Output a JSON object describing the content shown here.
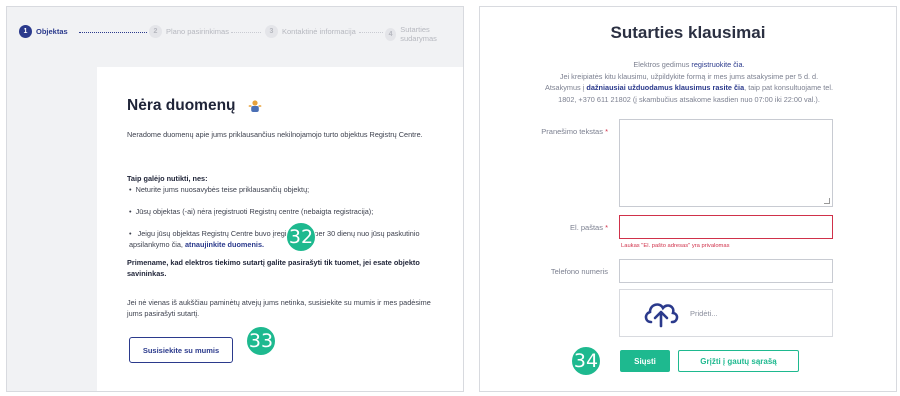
{
  "stepper": {
    "steps": [
      {
        "num": "1",
        "label": "Objektas"
      },
      {
        "num": "2",
        "label": "Plano pasirinkimas"
      },
      {
        "num": "3",
        "label": "Kontaktinė informacija"
      },
      {
        "num": "4",
        "label": "Sutarties sudarymas"
      }
    ]
  },
  "left": {
    "title": "Nėra duomenų",
    "intro": "Neradome duomenų apie jums priklausančius nekilnojamojo turto objektus Registrų Centre.",
    "reasons_title": "Taip galėjo nutikti, nes:",
    "reason1": "Neturite jums nuosavybės teise priklausančių objektų;",
    "reason2": "Jūsų objektas (-ai) nėra įregistruoti Registrų centre (nebaigta registracija);",
    "reason3_pre": "Jeigu jūsų objektas Registrų Centre buvo įregistruotas per 30 dienų nuo jūsų paskutinio apsilankymo čia,",
    "reason3_link": "atnaujinkite duomenis.",
    "reminder": "Primename, kad elektros tiekimo sutartį galite pasirašyti tik tuomet, jei esate objekto savininkas.",
    "contact_text": "Jei nė vienas iš aukščiau paminėtų atvejų jums netinka, susisiekite su mumis ir mes padėsime jums pasirašyti sutartį.",
    "contact_button": "Susisiekite su mumis"
  },
  "badges": {
    "b32": "32",
    "b33": "33",
    "b34": "34"
  },
  "right": {
    "title": "Sutarties klausimai",
    "desc_line1_pre": "Elektros gedimus",
    "desc_line1_link": "registruokite čia.",
    "desc_line2": "Jei kreipiatės kitu klausimu, užpildykite formą ir mes jums atsakysime per 5 d. d.",
    "desc_line3_pre": "Atsakymus į",
    "desc_line3_link": "dažniausiai užduodamus klausimus rasite čia",
    "desc_line3_post": ", taip pat konsultuojame tel.",
    "desc_line4": "1802, +370 611 21802 (į skambučius atsakome kasdien nuo 07:00 iki 22:00 val.).",
    "message_label": "Pranešimo tekstas",
    "email_label": "El. paštas",
    "required_mark": "*",
    "email_error": "Laukas \"El. pašto adresas\" yra privalomas",
    "phone_label": "Telefono numeris",
    "upload_label": "Pridėti...",
    "send_button": "Siųsti",
    "back_button": "Grįžti į gautų sąrašą"
  },
  "colors": {
    "accent": "#2b3a8c",
    "green": "#1eb98f",
    "error": "#d0314a"
  }
}
